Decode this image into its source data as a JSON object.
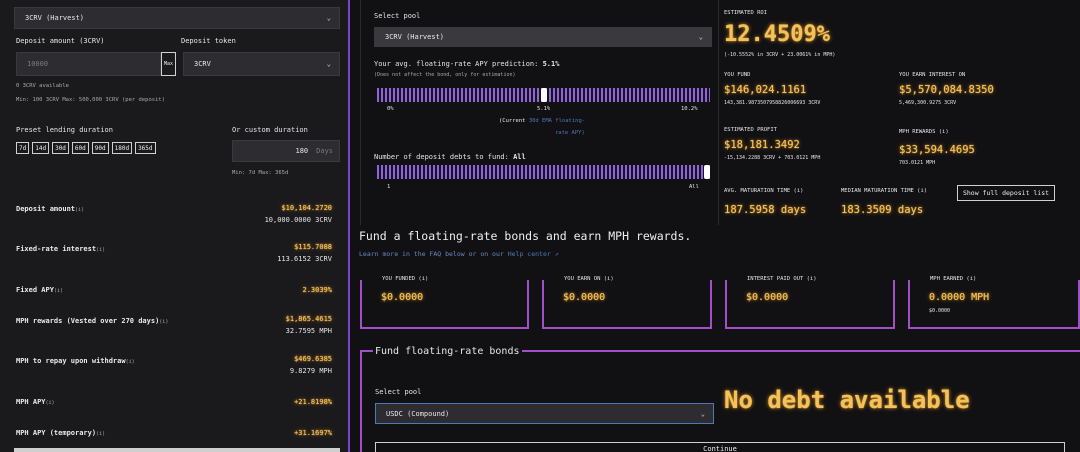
{
  "left": {
    "pool_select": "3CRV (Harvest)",
    "deposit_amount_label": "Deposit amount (3CRV)",
    "deposit_amount_placeholder": "10000",
    "max_button": "Max",
    "deposit_token_label": "Deposit token",
    "deposit_token_value": "3CRV",
    "available": "0 3CRV available",
    "limits": "Min: 100 3CRV Max: 500,000 3CRV (per deposit)",
    "preset_label": "Preset lending duration",
    "presets": [
      "7d",
      "14d",
      "30d",
      "60d",
      "90d",
      "180d",
      "365d"
    ],
    "custom_label": "Or custom duration",
    "custom_value": "180",
    "custom_unit": "Days",
    "custom_limits": "Min: 7d Max: 365d",
    "rows": [
      {
        "label": "Deposit amount",
        "info": "(i)",
        "value": "$10,104.2720",
        "sub": "10,000.0000 3CRV"
      },
      {
        "label": "Fixed-rate interest",
        "info": "(i)",
        "value": "$115.7088",
        "sub": "113.6152 3CRV"
      },
      {
        "label": "Fixed APY",
        "info": "(i)",
        "value": "2.3039%",
        "sub": ""
      },
      {
        "label": "MPH rewards (Vested over 270 days)",
        "info": "(i)",
        "value": "$1,865.4615",
        "sub": "32.7595 MPH"
      },
      {
        "label": "MPH to repay upon withdraw",
        "info": "(i)",
        "value": "$469.6385",
        "sub": "9.8279 MPH"
      },
      {
        "label": "MPH APY",
        "info": "(i)",
        "value": "+21.8198%",
        "sub": ""
      },
      {
        "label": "MPH APY (temporary)",
        "info": "(i)",
        "value": "+31.1697%",
        "sub": ""
      }
    ]
  },
  "mid": {
    "select_pool_label": "Select pool",
    "pool_value": "3CRV (Harvest)",
    "prediction_label": "Your avg. floating-rate APY prediction:",
    "prediction_value": "5.1%",
    "prediction_note": "(Does not affect the bond, only for estimation)",
    "prediction_slider_fraction": 0.5,
    "ticks": [
      "0%",
      "5.1%",
      "10.2%"
    ],
    "current_prefix": "(Current",
    "current_link": "30d EMA floating-",
    "current_suffix": "rate APY)",
    "debts_label": "Number of deposit debts to fund:",
    "debts_value": "All",
    "debts_slider_fraction": 1.0,
    "debts_ticks": [
      "1",
      "All"
    ]
  },
  "right": {
    "roi_label": "ESTIMATED ROI",
    "roi_value": "12.4509%",
    "roi_sub": "(-10.5552% in 3CRV + 23.0061% in MPH)",
    "you_fund_label": "YOU FUND",
    "you_fund_value": "$146,024.1161",
    "you_fund_sub": "143,381.9873507958826006693 3CRV",
    "interest_label": "YOU EARN INTEREST ON",
    "interest_value": "$5,570,084.8350",
    "interest_sub": "5,469,300.9275 3CRV",
    "profit_label": "ESTIMATED PROFIT",
    "profit_value": "$18,181.3492",
    "profit_sub": "-15,134.2288 3CRV + 703.0121 MPH",
    "mph_rewards_label": "MPH REWARDS (i)",
    "mph_rewards_value": "$33,594.4695",
    "mph_rewards_sub": "703.0121 MPH",
    "avg_label": "AVG. MATURATION TIME (i)",
    "avg_value": "187.5958 days",
    "median_label": "MEDIAN MATURATION TIME (i)",
    "median_value": "183.3509 days",
    "show_list": "Show full deposit list"
  },
  "fund_section": {
    "heading": "Fund a floating-rate bonds and earn MPH rewards.",
    "learn_prefix": "Learn more in the FAQ below or on our",
    "learn_link": "Help center",
    "cards": [
      {
        "label": "YOU FUNDED (i)",
        "value": "$0.0000",
        "sub": ""
      },
      {
        "label": "YOU EARN ON (i)",
        "value": "$0.0000",
        "sub": ""
      },
      {
        "label": "INTEREST PAID OUT (i)",
        "value": "$0.0000",
        "sub": ""
      },
      {
        "label": "MPH EARNED (i)",
        "value": "0.0000 MPH",
        "sub": "$0.0000"
      }
    ]
  },
  "bottom": {
    "title": "Fund floating-rate bonds",
    "select_pool_label": "Select pool",
    "pool_value": "USDC (Compound)",
    "no_debt": "No debt available",
    "continue": "Continue"
  },
  "colors": {
    "accent": "#a050c8",
    "gold": "#f3c25a",
    "purple": "#8f62e0"
  }
}
